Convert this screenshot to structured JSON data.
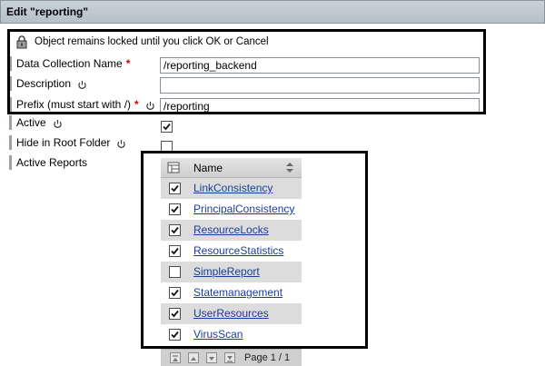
{
  "window": {
    "title": "Edit \"reporting\""
  },
  "lock_notice": {
    "text": "Object remains locked until you click OK or Cancel",
    "icon": "lock-icon"
  },
  "form": {
    "data_collection_name": {
      "label": "Data Collection Name",
      "required": "*",
      "value": "/reporting_backend"
    },
    "description": {
      "label": "Description",
      "value": ""
    },
    "prefix": {
      "label": "Prefix (must start with /)",
      "required": "*",
      "value": "/reporting"
    },
    "active": {
      "label": "Active",
      "checked": true
    },
    "hide_in_root_folder": {
      "label": "Hide in Root Folder",
      "checked": false
    },
    "active_reports": {
      "label": "Active Reports"
    }
  },
  "reports_table": {
    "column_name": "Name",
    "rows": [
      {
        "name": "LinkConsistency",
        "checked": true
      },
      {
        "name": "PrincipalConsistency",
        "checked": true
      },
      {
        "name": "ResourceLocks",
        "checked": true
      },
      {
        "name": "ResourceStatistics",
        "checked": true
      },
      {
        "name": "SimpleReport",
        "checked": false
      },
      {
        "name": "Statemanagement",
        "checked": true
      },
      {
        "name": "UserResources",
        "checked": true
      },
      {
        "name": "VirusScan",
        "checked": true
      }
    ],
    "pager": {
      "label": "Page 1 / 1"
    }
  },
  "colors": {
    "required": "#cc0000",
    "link": "#1a3d99",
    "highlight": "#000000"
  }
}
